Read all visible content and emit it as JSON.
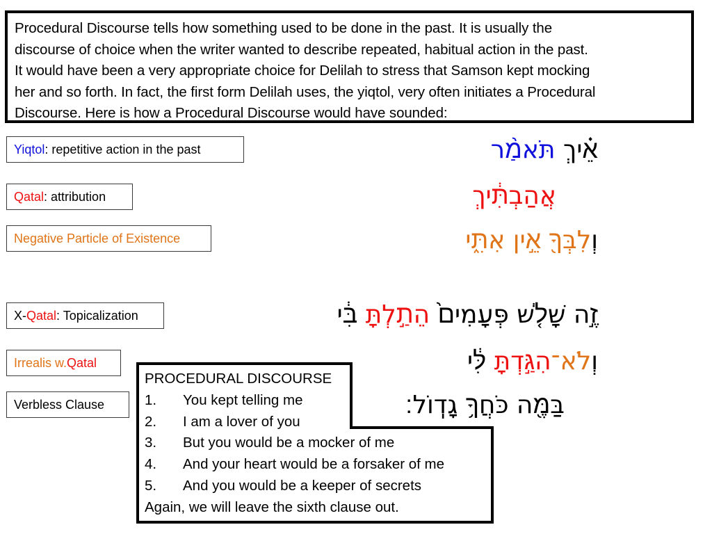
{
  "intro": {
    "lines": [
      "Procedural Discourse tells how something used to be done in the past. It is usually the",
      "discourse of choice when the writer wanted to describe repeated, habitual action in the past.",
      "It would have been a very appropriate choice for Delilah to stress that Samson kept mocking",
      "her and so forth. In fact, the first form Delilah uses, the yiqtol, very often initiates a Procedural",
      "Discourse. Here is how a Procedural Discourse would have sounded:"
    ]
  },
  "colors": {
    "yiqtol": "#1111dd",
    "qatal": "#ee1111",
    "negative_particle": "#e07418",
    "irrealis": "#e07418",
    "text": "#000000"
  },
  "labels": {
    "yiqtol": {
      "term": "Yiqtol",
      "rest": ": repetitive action in the past"
    },
    "qatal": {
      "term": "Qatal",
      "rest": ": attribution"
    },
    "negative": {
      "text": "Negative Particle of Existence"
    },
    "x_qatal": {
      "prefix": "X-",
      "term": "Qatal",
      "rest": ": Topicalization"
    },
    "irrealis": {
      "prefix": "Irrealis w. ",
      "term": "Qatal"
    },
    "verbless": {
      "text": "Verbless Clause"
    }
  },
  "hebrew": {
    "line1": {
      "black": "אֵ֗יךְ",
      "blue": "תֹּאמַ֨ר"
    },
    "line2": {
      "red": "אֲהַבְתִּ֔יךְ"
    },
    "line3": {
      "black": "וְ",
      "orange": "לִבְּךָ֖ אֵ֣ין אִתִּ֑י"
    },
    "line4": {
      "black1": "זֶ֣ה שָׁלֹ֤שׁ פְּעָמִים֙",
      "red": "הֵתַ֣לְתָּ",
      "black2": "בִּ֔י"
    },
    "line5": {
      "black1": "וְ",
      "orange": "לֹא־",
      "red": "הִגַּ֣דְתָּ",
      "black2": "לִּ֔י"
    },
    "line6": {
      "black": "בַּמֶּ֖ה כֹּחֲךָ֥ גָדֽוֹל׃"
    }
  },
  "procedural": {
    "title": "PROCEDURAL DISCOURSE",
    "items": [
      {
        "num": "1.",
        "text": "You kept telling me"
      },
      {
        "num": "2.",
        "text": "I am a lover of you"
      },
      {
        "num": "3.",
        "text": "But you would be a mocker of me"
      },
      {
        "num": "4.",
        "text": "And your heart would be a forsaker of me"
      },
      {
        "num": "5.",
        "text": "And you would be a keeper of secrets"
      }
    ],
    "footer": "Again, we will leave the sixth clause out."
  }
}
